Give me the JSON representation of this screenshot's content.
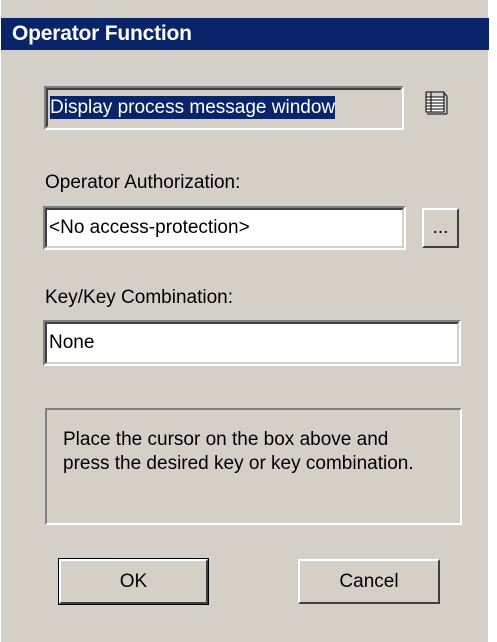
{
  "dialog": {
    "title": "Operator Function"
  },
  "function_field": {
    "value": "Display process message window",
    "icon": "list-view-icon"
  },
  "authorization": {
    "label": "Operator Authorization:",
    "value": "<No access-protection>",
    "browse_label": "..."
  },
  "key_combination": {
    "label": "Key/Key Combination:",
    "value": "None"
  },
  "info": {
    "line1": "Place the cursor on the box above and",
    "line2": "press the desired key or key combination."
  },
  "buttons": {
    "ok_label": "OK",
    "cancel_label": "Cancel"
  },
  "colors": {
    "title_bar": "#0a246a",
    "dialog_face": "#d4d0c8",
    "selection": "#0a246a"
  }
}
